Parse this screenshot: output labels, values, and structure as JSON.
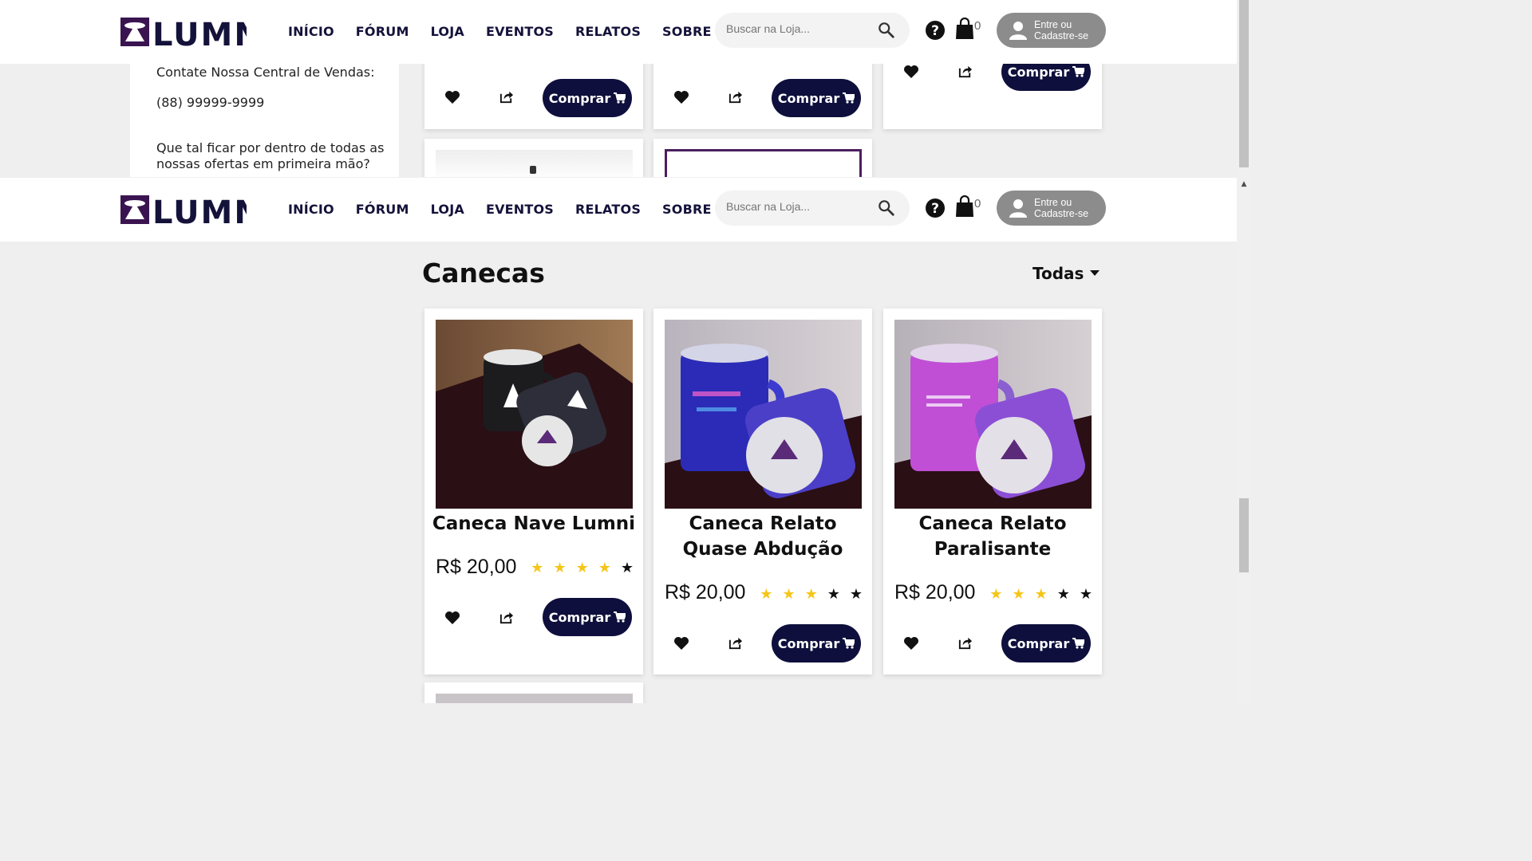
{
  "header": {
    "logo_text": "LUMNI",
    "nav": [
      "INÍCIO",
      "FÓRUM",
      "LOJA",
      "EVENTOS",
      "RELATOS",
      "SOBRE NÓS"
    ],
    "search_placeholder": "Buscar na Loja...",
    "cart_count": "0",
    "login_line1": "Entre ou",
    "login_line2": "Cadastre-se"
  },
  "sidebar": {
    "contact_label": "Contate Nossa Central de Vendas:",
    "phone": "(88) 99999-9999",
    "newsletter_line1": "Que tal ficar por dentro de todas as",
    "newsletter_line2": "nossas ofertas em primeira mão?"
  },
  "section": {
    "title": "Canecas",
    "filter_label": "Todas"
  },
  "buy_label": "Comprar",
  "products": [
    {
      "name": "Caneca Nave Lumni",
      "price": "R$ 20,00",
      "rating": 4,
      "mug_color": "#1c1c1e"
    },
    {
      "name": "Caneca Relato Quase Abdução",
      "price": "R$ 20,00",
      "rating": 3,
      "mug_color": "#2b2bb8"
    },
    {
      "name": "Caneca Relato Paralisante",
      "price": "R$ 20,00",
      "rating": 3,
      "mug_color": "#c04fd6"
    }
  ],
  "colors": {
    "brand_dark": "#0e0f3c",
    "star_on": "#f5c518",
    "star_off": "#111111",
    "brand_purple": "#4b1f5e"
  }
}
